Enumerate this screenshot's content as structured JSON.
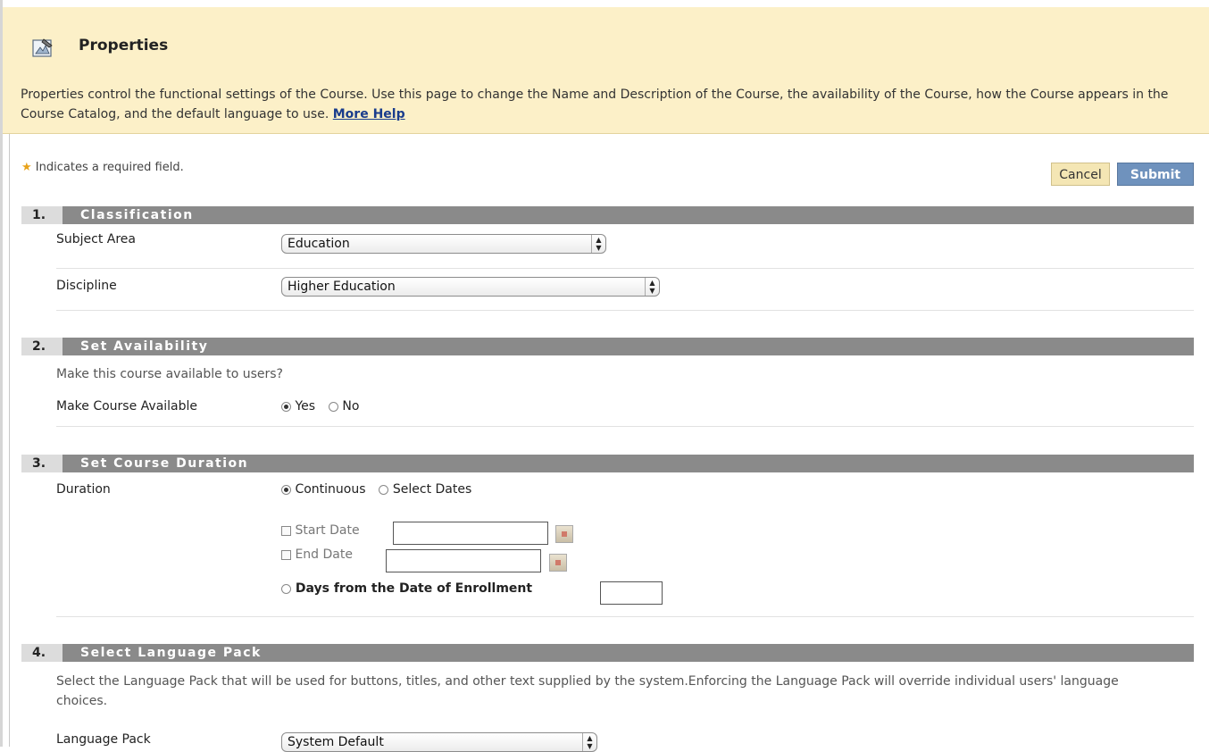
{
  "header": {
    "title": "Properties",
    "intro": "Properties control the functional settings of the Course. Use this page to change the Name and Description of the Course, the availability of the Course, how the Course appears in the Course Catalog, and the default language to use.",
    "more_help": "More Help"
  },
  "required_note": {
    "star": "★",
    "text": "Indicates a required field."
  },
  "buttons": {
    "cancel": "Cancel",
    "submit": "Submit"
  },
  "sections": [
    {
      "number": "1.",
      "title": "Classification"
    },
    {
      "number": "2.",
      "title": "Set Availability"
    },
    {
      "number": "3.",
      "title": "Set Course Duration"
    },
    {
      "number": "4.",
      "title": "Select Language Pack"
    }
  ],
  "classification": {
    "subject_area_label": "Subject Area",
    "subject_area_value": "Education",
    "discipline_label": "Discipline",
    "discipline_value": "Higher Education"
  },
  "availability": {
    "prompt": "Make this course available to users?",
    "label": "Make Course Available",
    "yes": "Yes",
    "no": "No",
    "selected": "Yes"
  },
  "duration": {
    "label": "Duration",
    "continuous": "Continuous",
    "select_dates": "Select Dates",
    "selected": "Continuous",
    "start_date": "Start Date",
    "end_date": "End Date",
    "days_from_enrollment": "Days from the Date of Enrollment"
  },
  "language": {
    "description": "Select the Language Pack that will be used for buttons, titles, and other text supplied by the system.Enforcing the Language Pack will override individual users' language choices.",
    "label": "Language Pack",
    "value": "System Default"
  },
  "colors": {
    "header_bg": "#fcf0c8",
    "section_bar": "#8a8a8a",
    "submit_bg": "#6f92bd",
    "cancel_bg": "#f4e6b4",
    "required_star": "#e8a21a",
    "link": "#1a3c8c"
  }
}
